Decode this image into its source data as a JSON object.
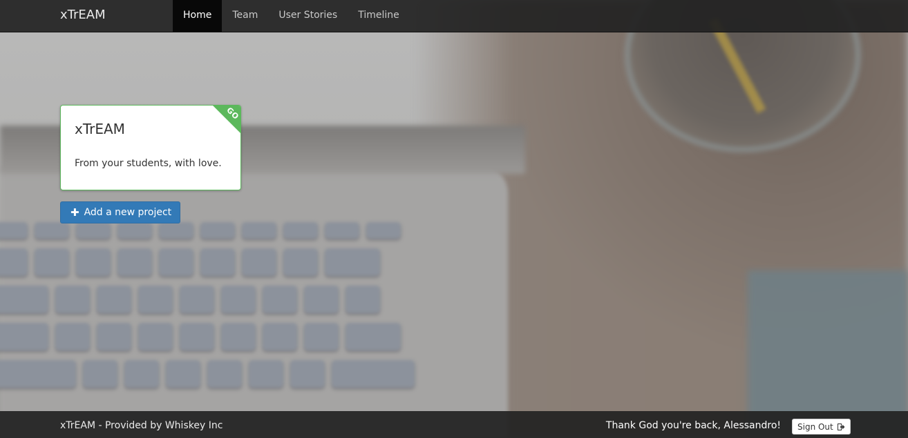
{
  "navbar": {
    "brand": "xTrEAM",
    "items": [
      {
        "label": "Home",
        "active": true
      },
      {
        "label": "Team",
        "active": false
      },
      {
        "label": "User Stories",
        "active": false
      },
      {
        "label": "Timeline",
        "active": false
      }
    ]
  },
  "project_card": {
    "title": "xTrEAM",
    "description": "From your students, with love.",
    "ribbon_label": "GO",
    "accent_color": "#5cb85c"
  },
  "add_project_button": {
    "icon": "plus-icon",
    "label": "Add a new project",
    "color": "#337ab7"
  },
  "footer": {
    "left_text": "xTrEAM - Provided by Whiskey Inc",
    "greeting": "Thank God you're back, Alessandro!",
    "sign_out_label": "Sign Out",
    "sign_out_icon": "logout-icon"
  }
}
